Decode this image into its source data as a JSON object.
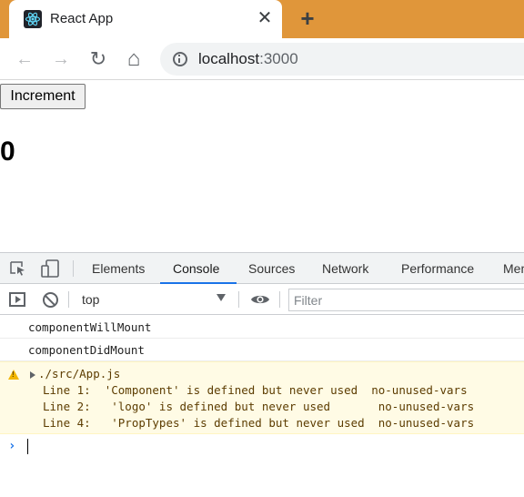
{
  "browser": {
    "tab_title": "React App",
    "favicon": "react-logo-icon",
    "close_glyph": "✕",
    "new_tab_glyph": "+",
    "url_host": "localhost",
    "url_port": ":3000"
  },
  "toolbar": {
    "back_glyph": "←",
    "forward_glyph": "→",
    "reload_glyph": "↻",
    "home_glyph": "⌂"
  },
  "page": {
    "button_label": "Increment",
    "counter_value": "0"
  },
  "devtools": {
    "tabs": [
      "Elements",
      "Console",
      "Sources",
      "Network",
      "Performance",
      "Mem"
    ],
    "active_tab": "Console",
    "context": "top",
    "filter_placeholder": "Filter",
    "logs": [
      "componentWillMount",
      "componentDidMount"
    ],
    "warning": {
      "file": "./src/App.js",
      "lines": [
        "Line 1:  'Component' is defined but never used  no-unused-vars",
        "Line 2:   'logo' is defined but never used       no-unused-vars",
        "Line 4:   'PropTypes' is defined but never used  no-unused-vars"
      ]
    },
    "prompt_glyph": "›"
  },
  "colors": {
    "tabstrip": "#e0963a",
    "active_tab_underline": "#1a73e8",
    "warning_bg": "#fffbe5"
  }
}
